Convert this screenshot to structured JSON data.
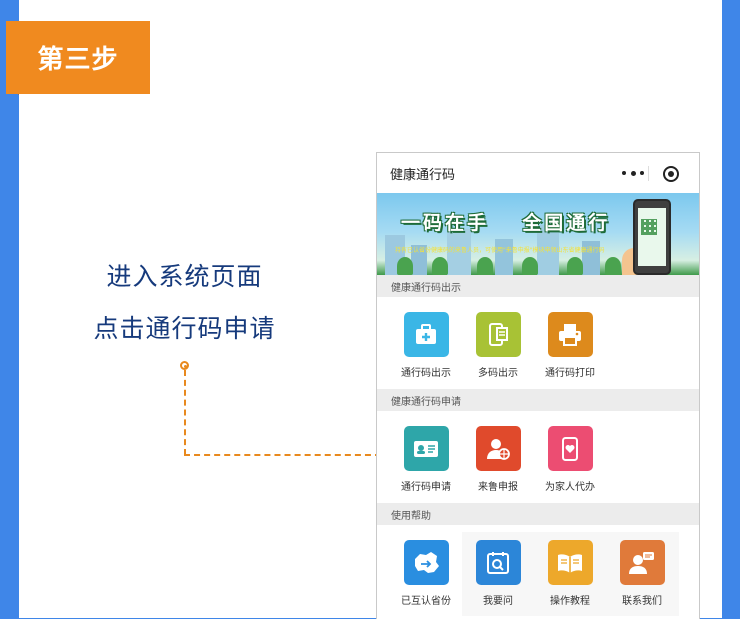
{
  "step_badge": "第三步",
  "description": [
    "进入系统页面",
    "点击通行码申请"
  ],
  "mini_app": {
    "title": "健康通行码",
    "capsule_icons": [
      "more-icon",
      "close-target-icon"
    ]
  },
  "banner": {
    "headline_left": "一码在手",
    "headline_right": "全国通行",
    "subtext": "持有已认省份健康码的来鲁人员，可使用\"来鲁申报\"模块申领山东省健康通行码"
  },
  "sections": [
    {
      "title": "健康通行码出示",
      "items": [
        {
          "label": "通行码出示",
          "icon": "briefcase-plus-icon",
          "color": "#3ab6e6"
        },
        {
          "label": "多码出示",
          "icon": "phone-doc-icon",
          "color": "#a8c235"
        },
        {
          "label": "通行码打印",
          "icon": "printer-icon",
          "color": "#dd8a1c"
        }
      ]
    },
    {
      "title": "健康通行码申请",
      "items": [
        {
          "label": "通行码申请",
          "icon": "id-card-icon",
          "color": "#2ea6a9"
        },
        {
          "label": "来鲁申报",
          "icon": "user-globe-icon",
          "color": "#e04a2c"
        },
        {
          "label": "为家人代办",
          "icon": "phone-heart-icon",
          "color": "#ec4d72"
        }
      ]
    },
    {
      "title": "使用帮助",
      "items": [
        {
          "label": "已互认省份",
          "icon": "china-map-icon",
          "color": "#2a8ee0"
        },
        {
          "label": "我要问",
          "icon": "calendar-search-icon",
          "color": "#2c86d8"
        },
        {
          "label": "操作教程",
          "icon": "book-icon",
          "color": "#eda82b"
        },
        {
          "label": "联系我们",
          "icon": "contact-card-icon",
          "color": "#e07a3a"
        }
      ]
    }
  ],
  "colors": {
    "page_bg": "#3f86e8",
    "badge": "#f08a1f",
    "connector": "#e8891e",
    "description_text": "#163a7c"
  }
}
